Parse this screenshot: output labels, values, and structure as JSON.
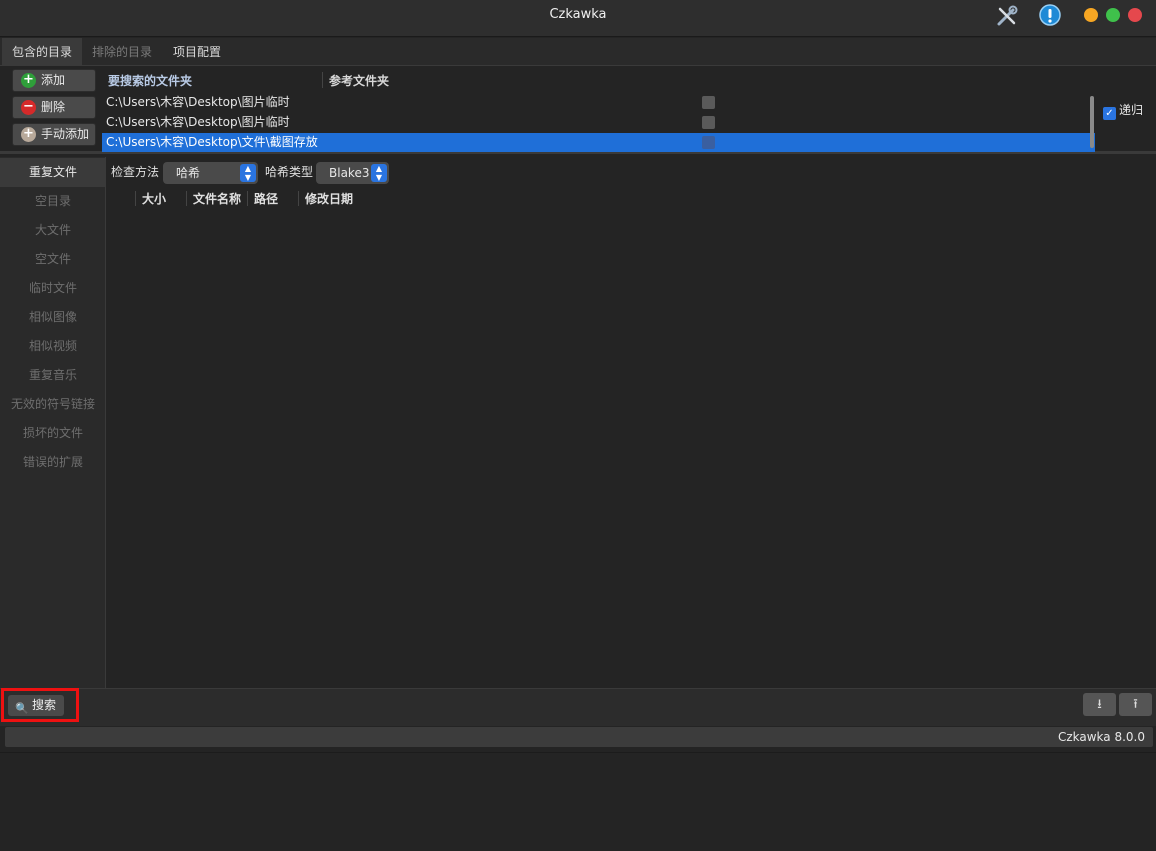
{
  "window": {
    "title": "Czkawka"
  },
  "tabs": [
    {
      "label": "包含的目录",
      "active": true
    },
    {
      "label": "排除的目录",
      "active": false
    },
    {
      "label": "项目配置",
      "active": false
    }
  ],
  "dirs": {
    "buttons": {
      "add": "添加",
      "remove": "删除",
      "manual_add": "手动添加"
    },
    "header_search": "要搜索的文件夹",
    "header_reference": "参考文件夹",
    "rows": [
      {
        "path": "C:\\Users\\木容\\Desktop\\图片临时",
        "reference": false,
        "selected": false
      },
      {
        "path": "C:\\Users\\木容\\Desktop\\图片临时",
        "reference": false,
        "selected": false
      },
      {
        "path": "C:\\Users\\木容\\Desktop\\文件\\截图存放",
        "reference": false,
        "selected": true
      }
    ],
    "recursive_label": "递归",
    "recursive_checked": true
  },
  "nav": {
    "items": [
      "重复文件",
      "空目录",
      "大文件",
      "空文件",
      "临时文件",
      "相似图像",
      "相似视频",
      "重复音乐",
      "无效的符号链接",
      "损坏的文件",
      "错误的扩展"
    ],
    "active_index": 0
  },
  "options": {
    "check_method_label": "检查方法",
    "check_method_value": "哈希",
    "hash_type_label": "哈希类型",
    "hash_type_value": "Blake3"
  },
  "columns": [
    "大小",
    "文件名称",
    "路径",
    "修改日期"
  ],
  "bottom": {
    "search_label": "搜索",
    "status_text": "Czkawka 8.0.0"
  },
  "colors": {
    "accent": "#1f6fd8",
    "highlight_box": "#ee1111",
    "background": "#242424"
  }
}
